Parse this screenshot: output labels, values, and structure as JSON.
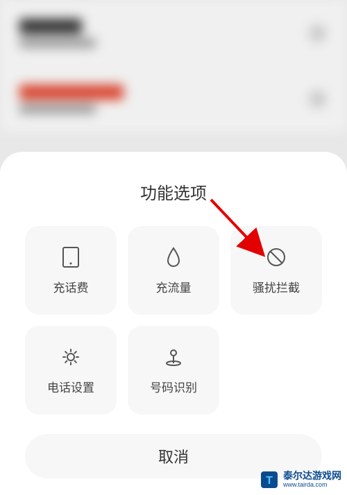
{
  "sheet": {
    "title": "功能选项",
    "options": [
      {
        "label": "充话费",
        "icon": "tablet"
      },
      {
        "label": "充流量",
        "icon": "droplet"
      },
      {
        "label": "骚扰拦截",
        "icon": "block"
      },
      {
        "label": "电话设置",
        "icon": "gear"
      },
      {
        "label": "号码识别",
        "icon": "pin"
      }
    ],
    "cancel": "取消"
  },
  "watermark": {
    "name": "泰尔达游戏网",
    "url": "www.tairda.com"
  }
}
